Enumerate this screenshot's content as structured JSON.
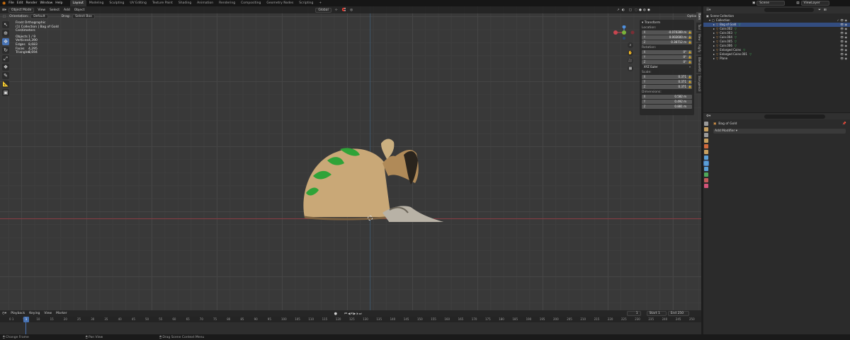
{
  "topbar": {
    "menus": [
      "File",
      "Edit",
      "Render",
      "Window",
      "Help"
    ],
    "workspaces": [
      "Layout",
      "Modeling",
      "Sculpting",
      "UV Editing",
      "Texture Paint",
      "Shading",
      "Animation",
      "Rendering",
      "Compositing",
      "Geometry Nodes",
      "Scripting"
    ],
    "active_workspace": "Layout",
    "scene": "Scene",
    "view_layer": "ViewLayer"
  },
  "viewport_header": {
    "mode": "Object Mode",
    "menus": [
      "View",
      "Select",
      "Add",
      "Object"
    ],
    "transform_orientation": "Global",
    "options_label": "Options",
    "orientation_label": "Orientation:",
    "orientation_value": "Default",
    "drag_label": "Drag:",
    "drag_value": "Select Box"
  },
  "stats": {
    "view": "Front Orthographic",
    "context": "(1) Collection | Bag of Gold",
    "units": "Centimeters",
    "rows": [
      {
        "k": "Objects",
        "v": "1 / 9"
      },
      {
        "k": "Vertices",
        "v": "4,390"
      },
      {
        "k": "Edges",
        "v": "8,683"
      },
      {
        "k": "Faces",
        "v": "4,295"
      },
      {
        "k": "Triangles",
        "v": "8,694"
      }
    ]
  },
  "npanel": {
    "title": "Transform",
    "location_label": "Location:",
    "location": [
      "-0.070289 m",
      "0.002600 m",
      "0.36712 m"
    ],
    "rotation_label": "Rotation:",
    "rotation": [
      "0°",
      "0°",
      "0°"
    ],
    "rotation_mode": "XYZ Euler",
    "scale_label": "Scale:",
    "scale": [
      "0.371",
      "0.371",
      "0.371"
    ],
    "dimensions_label": "Dimensions:",
    "dimensions": [
      "0.582 m",
      "0.492 m",
      "0.881 m"
    ],
    "axes": [
      "X",
      "Y",
      "Z"
    ],
    "side_tabs": [
      "Item",
      "Tool",
      "View",
      "Rigify",
      "BlenderKit",
      "Storypencil"
    ]
  },
  "outliner": {
    "root": "Scene Collection",
    "collection": "Collection",
    "items": [
      "Bag of Gold",
      "Coin.002",
      "Coin.003",
      "Coin.004",
      "Coin.005",
      "Coin.006",
      "Enlarged Coins",
      "Enlarged Coins.001",
      "Plane"
    ],
    "search_placeholder": ""
  },
  "properties": {
    "object_name": "Bag of Gold",
    "add_modifier": "Add Modifier",
    "tab_colors": [
      "#9a9a9a",
      "#c7a060",
      "#9a9a9a",
      "#c7a060",
      "#d26a3c",
      "#c7a060",
      "#5a9fd6",
      "#5a9fd6",
      "#5a9fd6",
      "#4fa85a",
      "#c45a5a",
      "#d4547a"
    ]
  },
  "timeline": {
    "menus": [
      "Playback",
      "Keying",
      "View",
      "Marker"
    ],
    "current_frame": "1",
    "start_label": "Start",
    "start": "1",
    "end_label": "End",
    "end": "250",
    "ticks": [
      "0",
      "1",
      "5",
      "10",
      "15",
      "20",
      "25",
      "30",
      "35",
      "40",
      "45",
      "50",
      "55",
      "60",
      "65",
      "70",
      "75",
      "80",
      "85",
      "90",
      "95",
      "100",
      "105",
      "110",
      "115",
      "120",
      "125",
      "130",
      "135",
      "140",
      "145",
      "150",
      "155",
      "160",
      "165",
      "170",
      "175",
      "180",
      "185",
      "190",
      "195",
      "200",
      "205",
      "210",
      "215",
      "220",
      "225",
      "230",
      "235",
      "240",
      "245",
      "250"
    ]
  },
  "statusbar": {
    "items": [
      "Change Frame",
      "Pan View",
      "Drag Scene Context Menu"
    ]
  },
  "colors": {
    "accent": "#4772b3",
    "x_axis": "#c8454f",
    "y_axis": "#7ab33a",
    "z_axis": "#4f8fdc"
  }
}
